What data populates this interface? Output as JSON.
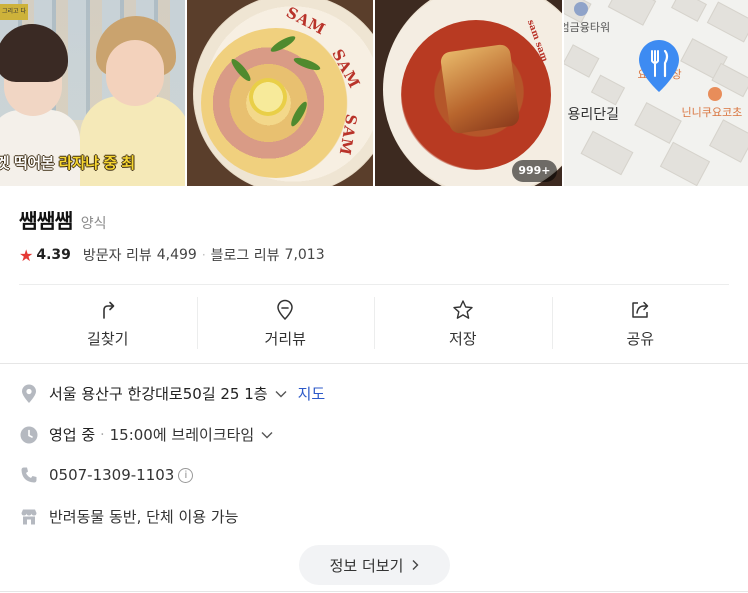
{
  "photos": {
    "video_caption_prefix": "겟 떡어본",
    "video_caption_highlight": "라자냐 중 최",
    "video_corner_label": "그리고 다",
    "plate_text_1": "SAM",
    "plate_text_2": "SAM",
    "plate_text_3": "SAM",
    "plate3_text": "sam sam",
    "photo_count_badge": "999+",
    "map": {
      "poi_top": "엄금융타워",
      "road_label": "용리단길",
      "poi_right": "닌니쿠요코초",
      "pin_label": "요",
      "pin_label_tail": "장",
      "pin_color": "#3d8bf2"
    }
  },
  "place": {
    "name": "쌤쌤쌤",
    "category": "양식",
    "rating": "4.39",
    "visitor_review_label": "방문자 리뷰",
    "visitor_review_count": "4,499",
    "blog_review_label": "블로그 리뷰",
    "blog_review_count": "7,013",
    "star_color": "#e53935"
  },
  "actions": [
    {
      "label": "길찾기",
      "icon": "directions-icon"
    },
    {
      "label": "거리뷰",
      "icon": "street-view-icon"
    },
    {
      "label": "저장",
      "icon": "star-icon"
    },
    {
      "label": "공유",
      "icon": "share-icon"
    }
  ],
  "info": {
    "address": "서울 용산구 한강대로50길 25 1층",
    "map_link": "지도",
    "hours_status": "영업 중",
    "hours_detail": "15:00에 브레이크타임",
    "phone": "0507-1309-1103",
    "amenities": "반려동물 동반, 단체 이용 가능",
    "more_button": "정보 더보기",
    "link_color": "#2c59c8"
  }
}
